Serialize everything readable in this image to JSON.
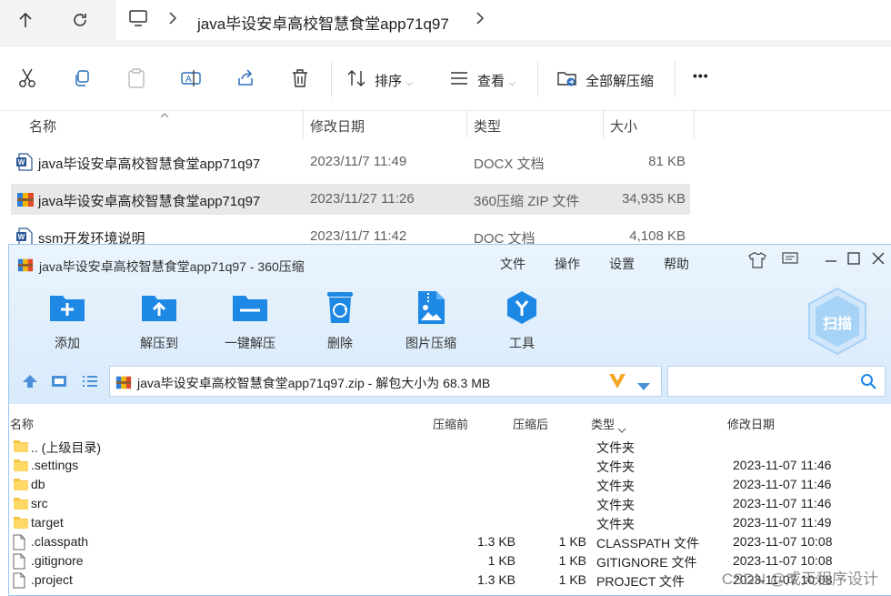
{
  "explorer": {
    "breadcrumb": [
      "java毕设安卓高校智慧食堂app71q97"
    ],
    "toolbar": {
      "sort_label": "排序",
      "view_label": "查看",
      "extract_all_label": "全部解压缩",
      "more_label": "•••"
    },
    "columns": {
      "name": "名称",
      "modified": "修改日期",
      "type": "类型",
      "size": "大小"
    },
    "files": [
      {
        "name": "java毕设安卓高校智慧食堂app71q97",
        "modified": "2023/11/7 11:49",
        "type": "DOCX 文档",
        "size": "81 KB",
        "icon": "word-doc-icon",
        "selected": false
      },
      {
        "name": "java毕设安卓高校智慧食堂app71q97",
        "modified": "2023/11/27 11:26",
        "type": "360压缩 ZIP 文件",
        "size": "34,935 KB",
        "icon": "zip-archive-icon",
        "selected": true
      },
      {
        "name": "ssm开发环境说明",
        "modified": "2023/11/7 11:42",
        "type": "DOC 文档",
        "size": "4,108 KB",
        "icon": "word-doc-icon",
        "selected": false
      }
    ]
  },
  "zipwin": {
    "title": "java毕设安卓高校智慧食堂app71q97 - 360压缩",
    "menu": [
      "文件",
      "操作",
      "设置",
      "帮助"
    ],
    "buttons": [
      {
        "label": "添加",
        "icon": "add-folder-icon"
      },
      {
        "label": "解压到",
        "icon": "extract-to-icon"
      },
      {
        "label": "一键解压",
        "icon": "one-click-extract-icon"
      },
      {
        "label": "删除",
        "icon": "recycle-delete-icon"
      },
      {
        "label": "图片压缩",
        "icon": "image-compress-icon"
      },
      {
        "label": "工具",
        "icon": "tools-icon"
      }
    ],
    "scan_label": "扫描",
    "path": "java毕设安卓高校智慧食堂app71q97.zip - 解包大小为 68.3 MB",
    "search_placeholder": "",
    "columns": {
      "name": "名称",
      "before": "压缩前",
      "after": "压缩后",
      "type": "类型",
      "modified": "修改日期"
    },
    "rows": [
      {
        "name": ".. (上级目录)",
        "before": "",
        "after": "",
        "type": "文件夹",
        "modified": "",
        "icon": "folder-icon"
      },
      {
        "name": ".settings",
        "before": "",
        "after": "",
        "type": "文件夹",
        "modified": "2023-11-07 11:46",
        "icon": "folder-icon"
      },
      {
        "name": "db",
        "before": "",
        "after": "",
        "type": "文件夹",
        "modified": "2023-11-07 11:46",
        "icon": "folder-icon"
      },
      {
        "name": "src",
        "before": "",
        "after": "",
        "type": "文件夹",
        "modified": "2023-11-07 11:46",
        "icon": "folder-icon"
      },
      {
        "name": "target",
        "before": "",
        "after": "",
        "type": "文件夹",
        "modified": "2023-11-07 11:49",
        "icon": "folder-icon"
      },
      {
        "name": ".classpath",
        "before": "1.3 KB",
        "after": "1 KB",
        "type": "CLASSPATH 文件",
        "modified": "2023-11-07 10:08",
        "icon": "file-icon"
      },
      {
        "name": ".gitignore",
        "before": "1 KB",
        "after": "1 KB",
        "type": "GITIGNORE 文件",
        "modified": "2023-11-07 10:08",
        "icon": "file-icon"
      },
      {
        "name": ".project",
        "before": "1.3 KB",
        "after": "1 KB",
        "type": "PROJECT 文件",
        "modified": "2023-11-07 10:08",
        "icon": "file-icon"
      }
    ]
  },
  "watermark": "CSDN @成天程序设计",
  "colors": {
    "accent_blue": "#1e88e5",
    "selection_gray": "#e8e8e8",
    "folder_yellow": "#f5c342",
    "zip_header_bg": "#dcecfb"
  }
}
